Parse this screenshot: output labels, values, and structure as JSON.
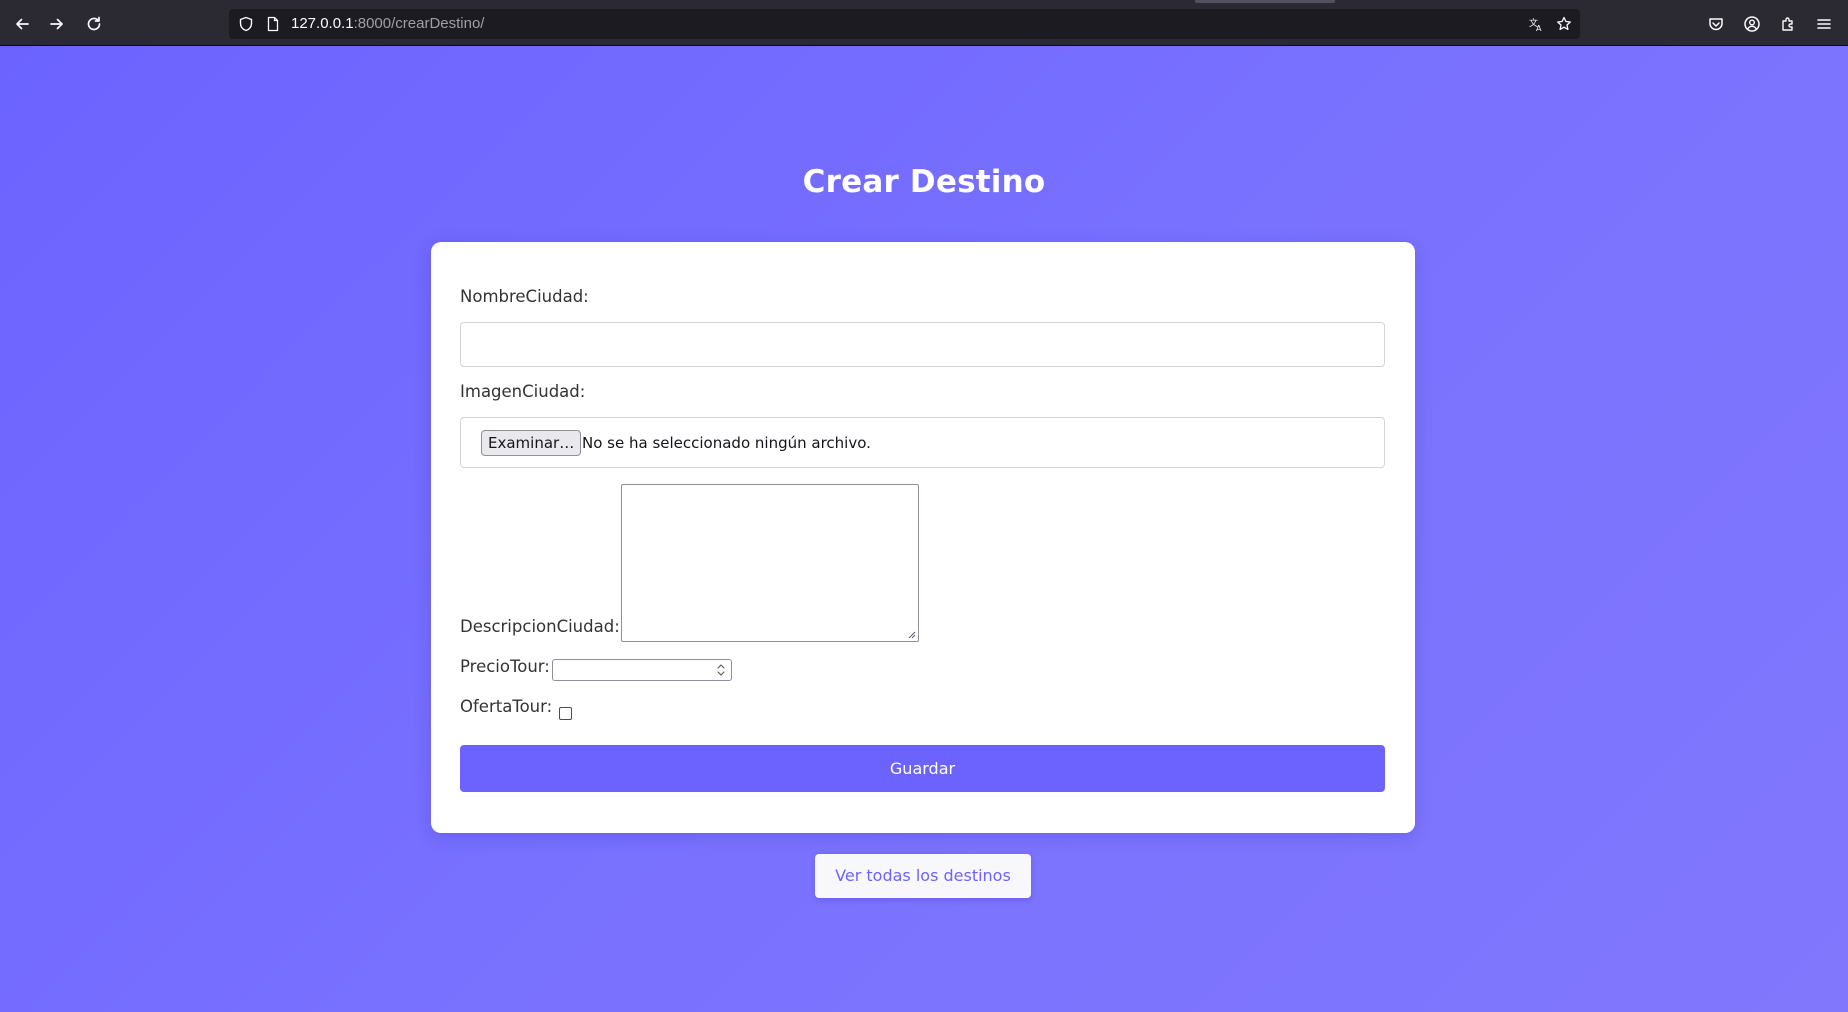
{
  "browser": {
    "url_host": "127.0.0.1",
    "url_path": ":8000/crearDestino/"
  },
  "page": {
    "title": "Crear Destino"
  },
  "form": {
    "nombre_label": "NombreCiudad:",
    "nombre_value": "",
    "imagen_label": "ImagenCiudad:",
    "file_button_label": "Examinar…",
    "file_status": "No se ha seleccionado ningún archivo.",
    "descripcion_label": "DescripcionCiudad:",
    "descripcion_value": "",
    "precio_label": "PrecioTour:",
    "precio_value": "",
    "oferta_label": "OfertaTour:",
    "oferta_checked": false,
    "save_label": "Guardar"
  },
  "footer": {
    "all_destinations_label": "Ver todas los destinos"
  },
  "colors": {
    "accent": "#6c63ff",
    "browser_bg": "#2b2a33",
    "card_bg": "#ffffff"
  }
}
